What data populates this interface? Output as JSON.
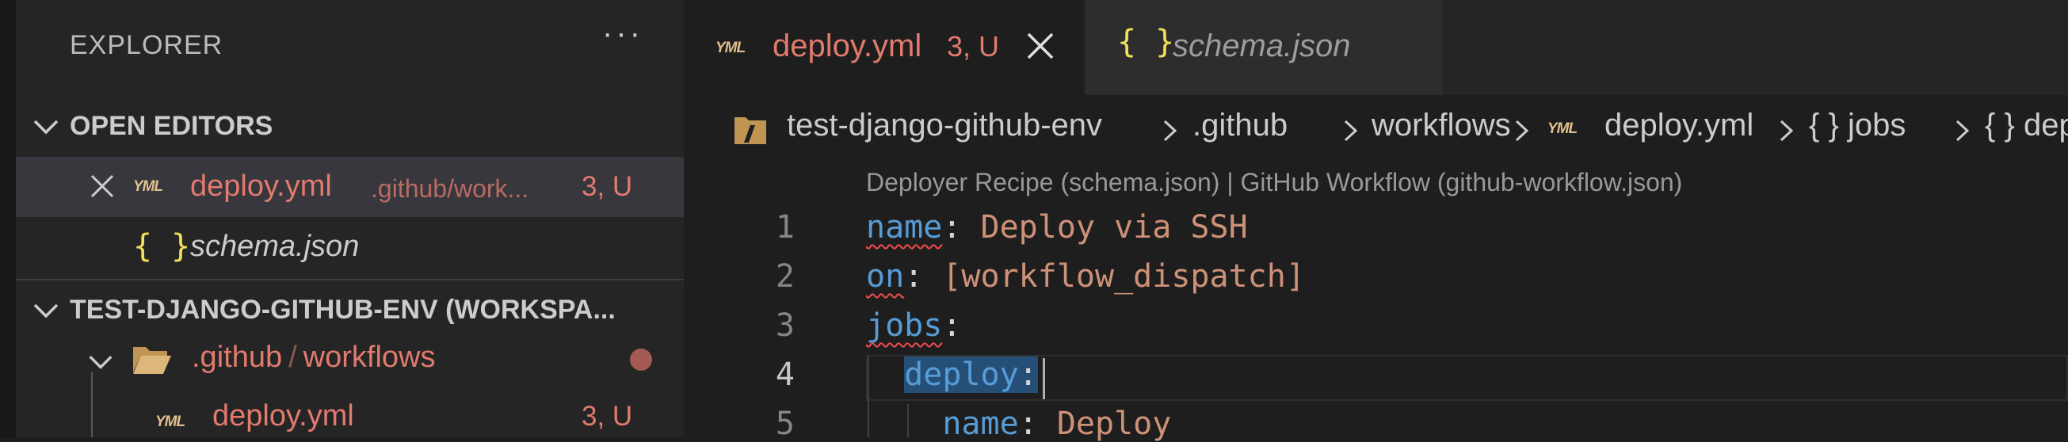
{
  "sidebar": {
    "title": "EXPLORER",
    "more": "···",
    "open_editors": {
      "label": "OPEN EDITORS",
      "items": [
        {
          "name": "deploy.yml",
          "path": ".github/work...",
          "badge": "3, U"
        },
        {
          "name": "schema.json"
        }
      ]
    },
    "workspace": {
      "label": "TEST-DJANGO-GITHUB-ENV (WORKSPA...",
      "folder": {
        "part1": ".github",
        "sep": "/",
        "part2": "workflows"
      },
      "file": {
        "name": "deploy.yml",
        "badge": "3, U"
      }
    }
  },
  "tabs": [
    {
      "name": "deploy.yml",
      "badge": "3, U",
      "icon": "yml-icon",
      "active": true
    },
    {
      "name": "schema.json",
      "icon": "json-icon",
      "active": false
    }
  ],
  "breadcrumb": {
    "workspace": "test-django-github-env",
    "seg1": ".github",
    "seg2": "workflows",
    "file": "deploy.yml",
    "seg3": "{ } jobs",
    "seg4": "{ } dep"
  },
  "codelens": "Deployer Recipe (schema.json) | GitHub Workflow (github-workflow.json)",
  "lines": {
    "n1": "1",
    "n2": "2",
    "n3": "3",
    "n4": "4",
    "n5": "5",
    "l1_key": "name",
    "l1_val": "Deploy via SSH",
    "l2_key": "on",
    "l2_val": "[workflow_dispatch]",
    "l3_key": "jobs",
    "l4_key": "deploy",
    "l5_key": "name",
    "l5_val": "Deploy"
  },
  "colors": {
    "modified": "#e27a6d",
    "yaml_key": "#569cd6",
    "yaml_string": "#ce9178",
    "error_squiggle": "#f14c4c"
  },
  "icon_text": {
    "yml": "YML",
    "json": "{ }",
    "close": "×"
  }
}
